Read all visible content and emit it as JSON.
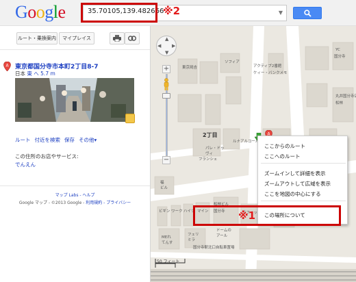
{
  "header": {
    "logo_text": "Google",
    "search_value": "35.70105,139.482666",
    "annotation_2": "※2"
  },
  "panel": {
    "route_button": "ルート・乗換案内",
    "myplaces_button": "マイプレイス",
    "place": {
      "marker": "A",
      "title": "東京都国分寺市本町2丁目8-7",
      "country": "日本",
      "direction": "東 へ 5.7 m"
    },
    "actions": [
      "ルート",
      "付近を検索",
      "保存",
      "その他▾"
    ],
    "business_label": "この住所のお店やサービス:",
    "business_link": "でんえん",
    "footer_links": "マップ Labs - ヘルプ",
    "footer_prefix": "Google マップ - ©2013 Google - ",
    "footer_terms": "利用規約 - プライバシー"
  },
  "map": {
    "labels": [
      "東京岡吉",
      "ソフィア",
      "アクティブ2番館",
      "ケィー・バンクメモ",
      "YC",
      "国分寺",
      "丸井国分寺店",
      "松林",
      "2丁目",
      "パレ・ドゥ",
      "ヴィ",
      "フランシェ",
      "ルナアルコール",
      "福",
      "ビル",
      "ビギン",
      "ワーク",
      "ハイツ",
      "マイン",
      "松林ビル",
      "国分寺",
      "MEれ",
      "てんす",
      "フェリ",
      "ミラ",
      "ドームの",
      "アール",
      "ラフィット",
      "国分寺駅北口自転車置場"
    ],
    "scale_label": "50 フィート",
    "scale_label_metric": "20 m",
    "marker": "A",
    "annotation_1": "※1"
  },
  "context_menu": {
    "items": [
      "ここからのルート",
      "ここへのルート",
      "ズームインして詳細を表示",
      "ズームアウトして広域を表示",
      "ここを地図の中心にする",
      "この場所について"
    ]
  },
  "colors": {
    "link": "#1a3dc1",
    "highlight_red": "#cc0000",
    "search_button": "#4a8af4",
    "map_background": "#ebe8e1"
  }
}
